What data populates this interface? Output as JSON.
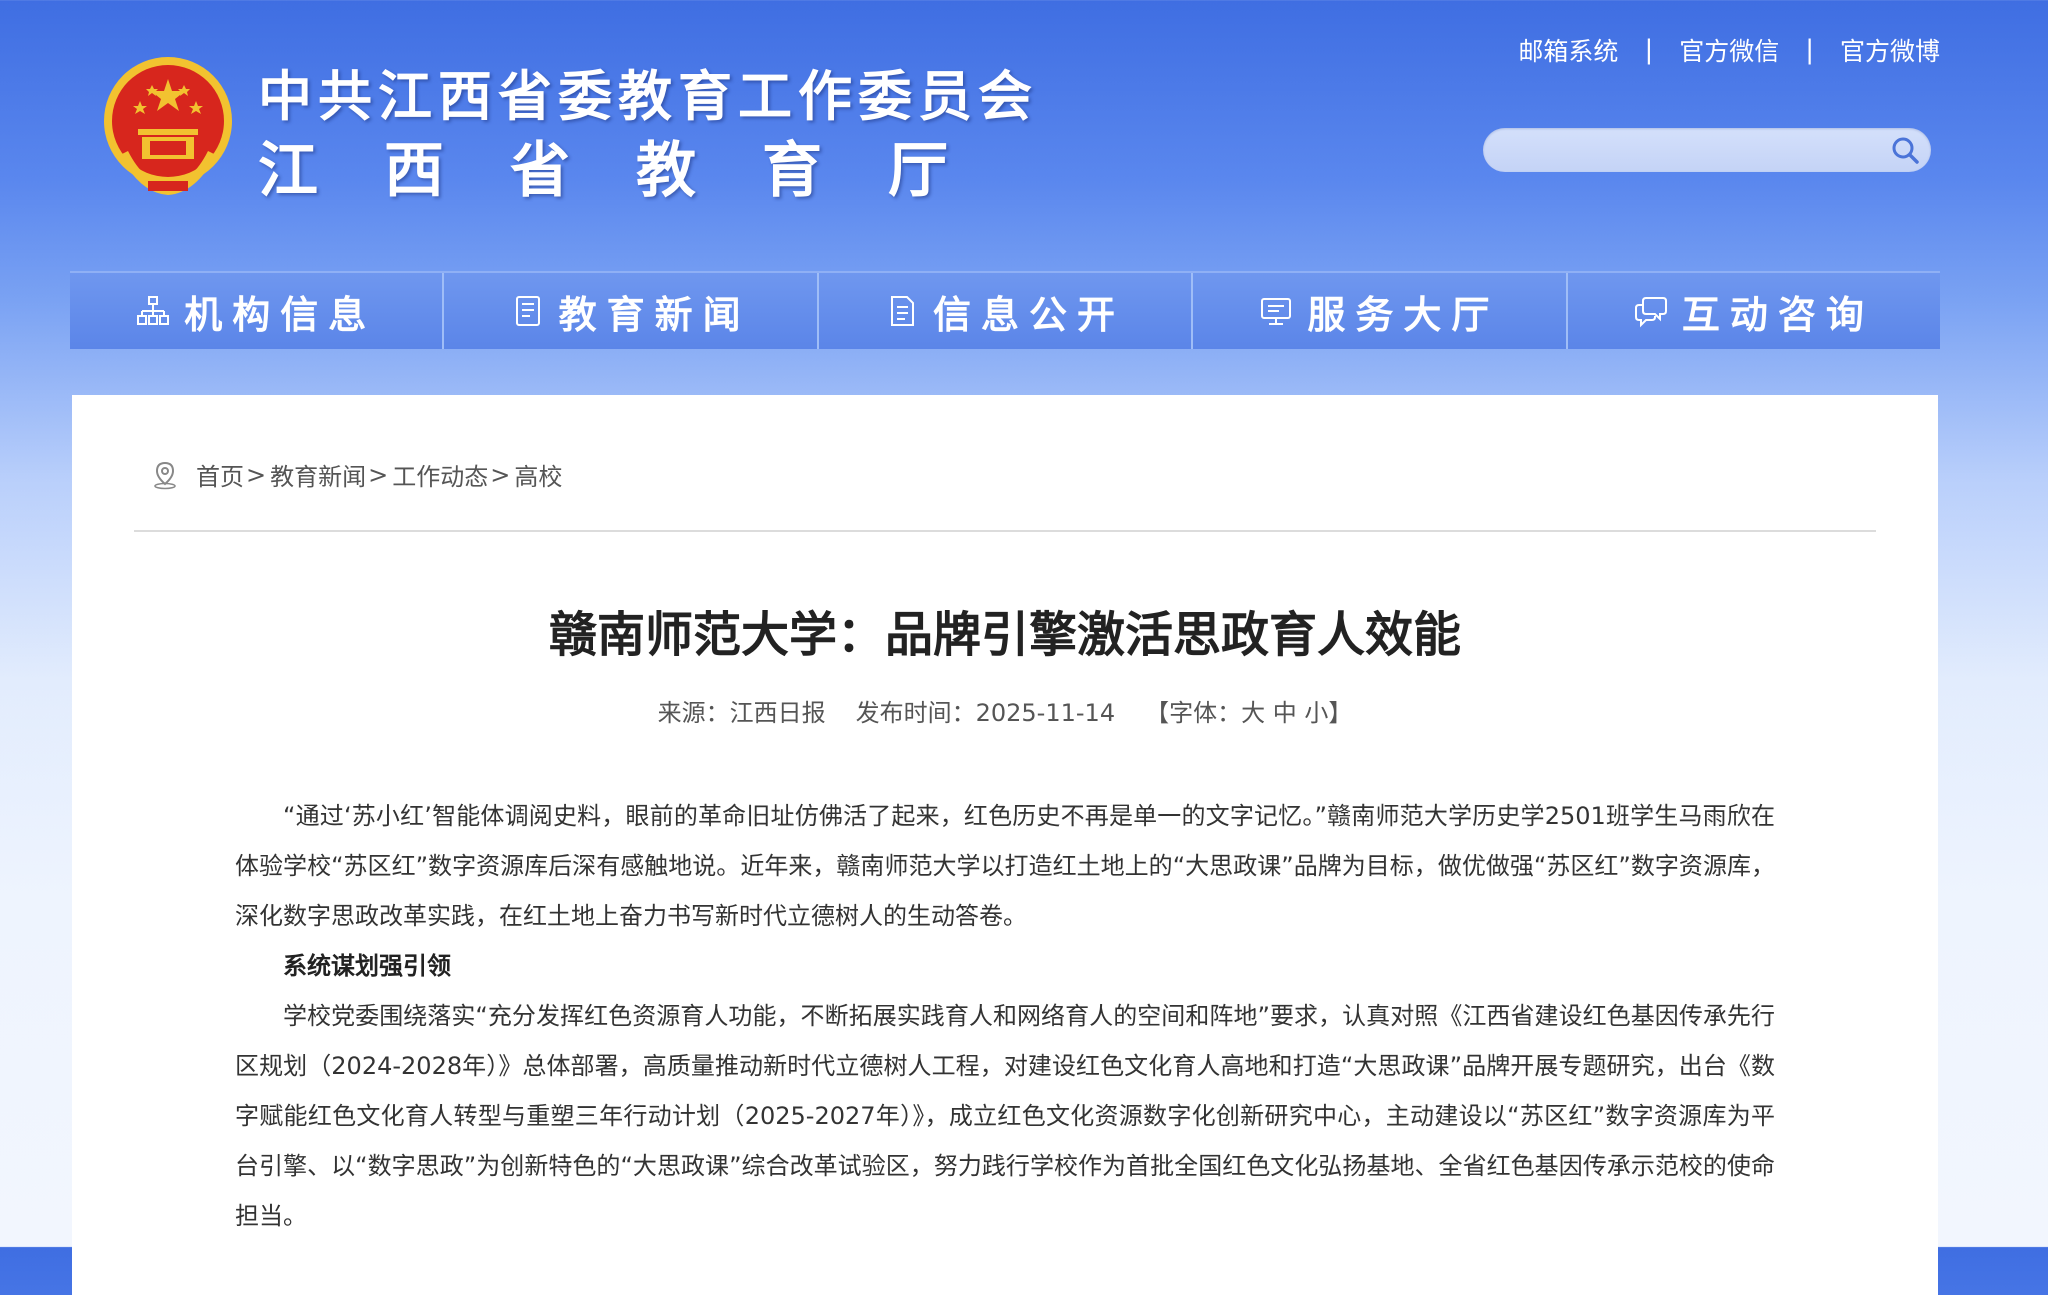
{
  "header": {
    "org_name_line1": "中共江西省委教育工作委员会",
    "org_name_line2_chars": [
      "江",
      "西",
      "省",
      "教",
      "育",
      "厅"
    ],
    "top_links": [
      "邮箱系统",
      "官方微信",
      "官方微博"
    ],
    "separator": "|",
    "search": {
      "value": "",
      "placeholder": ""
    }
  },
  "nav": {
    "items": [
      {
        "label": "机构信息",
        "icon": "org-chart-icon"
      },
      {
        "label": "教育新闻",
        "icon": "news-icon"
      },
      {
        "label": "信息公开",
        "icon": "document-icon"
      },
      {
        "label": "服务大厅",
        "icon": "monitor-icon"
      },
      {
        "label": "互动咨询",
        "icon": "chat-bubbles-icon"
      }
    ]
  },
  "breadcrumb": {
    "items": [
      "首页",
      "教育新闻",
      "工作动态",
      "高校"
    ],
    "separator": ">"
  },
  "article": {
    "title": "赣南师范大学：品牌引擎激活思政育人效能",
    "source": "来源：江西日报",
    "publish_time": "发布时间：2025-11-14",
    "font_size_prefix": "【字体：",
    "font_sizes": [
      "大",
      "中",
      "小"
    ],
    "font_size_suffix": "】",
    "paragraphs": [
      "“通过‘苏小红’智能体调阅史料，眼前的革命旧址仿佛活了起来，红色历史不再是单一的文字记忆。”赣南师范大学历史学2501班学生马雨欣在体验学校“苏区红”数字资源库后深有感触地说。近年来，赣南师范大学以打造红土地上的“大思政课”品牌为目标，做优做强“苏区红”数字资源库，深化数字思政改革实践，在红土地上奋力书写新时代立德树人的生动答卷。",
      "系统谋划强引领",
      "学校党委围绕落实“充分发挥红色资源育人功能，不断拓展实践育人和网络育人的空间和阵地”要求，认真对照《江西省建设红色基因传承先行区规划（2024-2028年）》总体部署，高质量推动新时代立德树人工程，对建设红色文化育人高地和打造“大思政课”品牌开展专题研究，出台《数字赋能红色文化育人转型与重塑三年行动计划（2025-2027年）》，成立红色文化资源数字化创新研究中心，主动建设以“苏区红”数字资源库为平台引擎、以“数字思政”为创新特色的“大思政课”综合改革试验区，努力践行学校作为首批全国红色文化弘扬基地、全省红色基因传承示范校的使命担当。"
    ]
  },
  "colors": {
    "header_blue": "#3f6ee2",
    "nav_blue": "#5b85e8",
    "emblem_red": "#d7261d",
    "emblem_gold": "#f2c230"
  }
}
